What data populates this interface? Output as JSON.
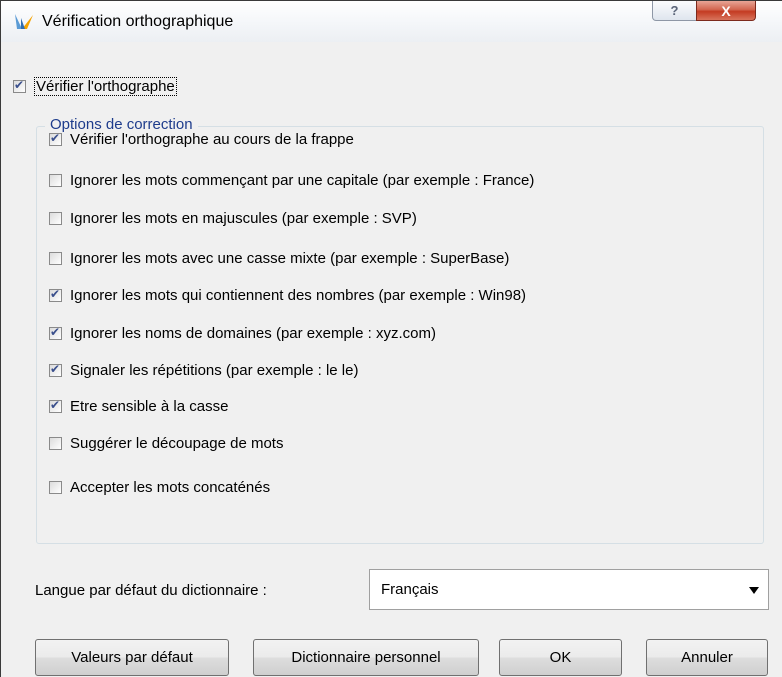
{
  "window": {
    "title": "Vérification orthographique",
    "help_label": "?",
    "close_label": "X"
  },
  "spell_check": {
    "label": "Vérifier l'orthographe",
    "checked": true
  },
  "group": {
    "legend": "Options de correction"
  },
  "options": [
    {
      "label": "Vérifier l'orthographe au cours de la frappe",
      "checked": true
    },
    {
      "label": "Ignorer les mots commençant par une capitale (par exemple : France)",
      "checked": false
    },
    {
      "label": "Ignorer les mots en majuscules (par exemple : SVP)",
      "checked": false
    },
    {
      "label": "Ignorer les mots avec une casse mixte (par exemple : SuperBase)",
      "checked": false
    },
    {
      "label": "Ignorer les mots qui contiennent des nombres (par exemple : Win98)",
      "checked": true
    },
    {
      "label": "Ignorer les noms de domaines (par exemple : xyz.com)",
      "checked": true
    },
    {
      "label": "Signaler les répétitions (par exemple : le le)",
      "checked": true
    },
    {
      "label": "Etre sensible à la casse",
      "checked": true
    },
    {
      "label": "Suggérer le découpage de mots",
      "checked": false
    },
    {
      "label": "Accepter les mots concaténés",
      "checked": false
    }
  ],
  "language": {
    "label": "Langue par défaut du dictionnaire :",
    "selected": "Français"
  },
  "buttons": {
    "defaults": "Valeurs par défaut",
    "personal_dictionary": "Dictionnaire personnel",
    "ok": "OK",
    "cancel": "Annuler"
  },
  "icons": {
    "app": "app-logo-icon",
    "dropdown": "chevron-down-icon"
  },
  "colors": {
    "legend": "#1e3c8c",
    "check": "#3a4f8c",
    "close": "#c43b22"
  }
}
